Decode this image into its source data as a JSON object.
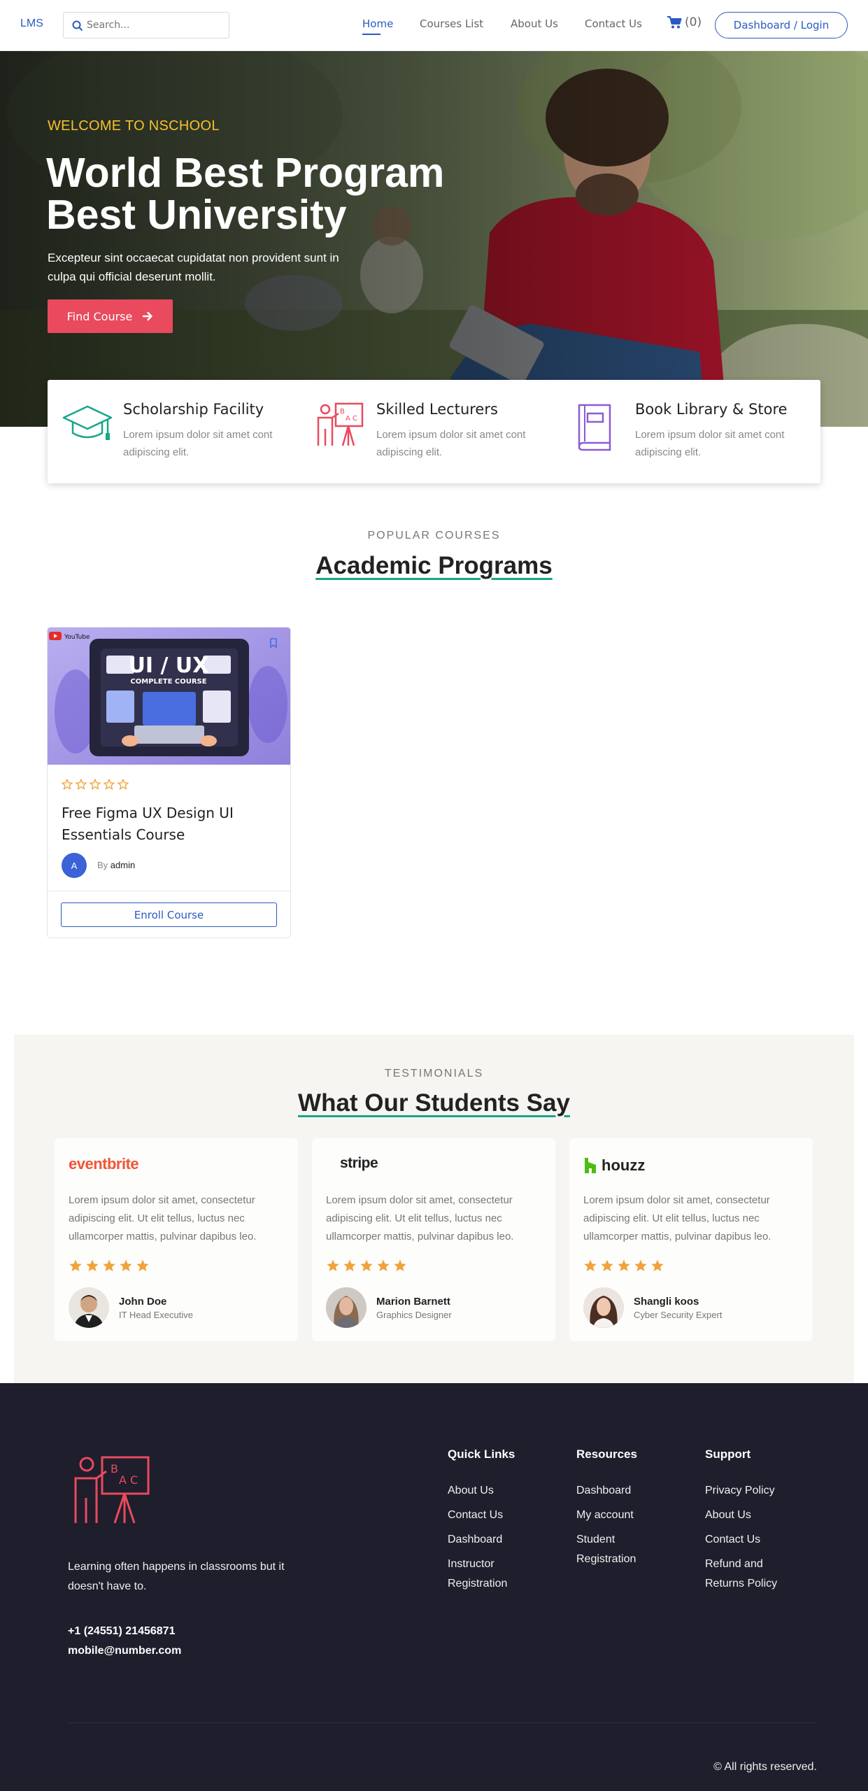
{
  "header": {
    "logo": "LMS",
    "search_placeholder": "Search...",
    "nav": [
      "Home",
      "Courses List",
      "About Us",
      "Contact Us"
    ],
    "cart_count": "(0)",
    "dashboard_label": "Dashboard / Login",
    "accent_color": "#2b59c3"
  },
  "hero": {
    "welcome": "WELCOME TO NSCHOOL",
    "title_line1": "World Best Program",
    "title_line2": "Best University",
    "text": "Excepteur sint occaecat cupidatat non provident sunt in culpa qui official deserunt mollit.",
    "button": "Find Course"
  },
  "features": [
    {
      "icon": "graduation-cap-icon",
      "title": "Scholarship Facility",
      "text": "Lorem ipsum dolor sit amet cont adipiscing elit."
    },
    {
      "icon": "teacher-board-icon",
      "title": "Skilled Lecturers",
      "text": "Lorem ipsum dolor sit amet cont adipiscing elit."
    },
    {
      "icon": "book-icon",
      "title": "Book Library & Store",
      "text": "Lorem ipsum dolor sit amet cont adipiscing elit."
    }
  ],
  "courses": {
    "eyebrow": "POPULAR COURSES",
    "title": "Academic Programs",
    "card": {
      "thumb_label_youtube": "YouTube",
      "thumb_title": "UI / UX",
      "thumb_subtitle": "COMPLETE COURSE",
      "rating": 0,
      "title": "Free Figma UX Design UI Essentials Course",
      "author_initial": "A",
      "by": "By",
      "author": "admin",
      "enroll": "Enroll Course"
    }
  },
  "testimonials": {
    "eyebrow": "TESTIMONIALS",
    "title": "What Our Students Say",
    "items": [
      {
        "brand": "eventbrite",
        "text": "Lorem ipsum dolor sit amet, consectetur adipiscing elit. Ut elit tellus, luctus nec ullamcorper mattis, pulvinar dapibus leo.",
        "rating": 5,
        "name": "John Doe",
        "role": "IT Head Executive"
      },
      {
        "brand": "stripe",
        "text": "Lorem ipsum dolor sit amet, consectetur adipiscing elit. Ut elit tellus, luctus nec ullamcorper mattis, pulvinar dapibus leo.",
        "rating": 5,
        "name": "Marion Barnett",
        "role": "Graphics Designer"
      },
      {
        "brand": "houzz",
        "text": "Lorem ipsum dolor sit amet, consectetur adipiscing elit. Ut elit tellus, luctus nec ullamcorper mattis, pulvinar dapibus leo.",
        "rating": 5,
        "name": "Shangli koos",
        "role": "Cyber Security Expert"
      }
    ]
  },
  "footer": {
    "tagline": "Learning often happens in classrooms but it doesn't have to.",
    "phone": "+1 (24551) 21456871",
    "email": "mobile@number.com",
    "columns": [
      {
        "title": "Quick Links",
        "links": [
          "About Us",
          "Contact Us",
          "Dashboard",
          "Instructor Registration"
        ]
      },
      {
        "title": "Resources",
        "links": [
          "Dashboard",
          "My account",
          "Student Registration"
        ]
      },
      {
        "title": "Support",
        "links": [
          "Privacy Policy",
          "About Us",
          "Contact Us",
          "Refund and Returns Policy"
        ]
      }
    ],
    "copyright": "© All rights reserved."
  }
}
